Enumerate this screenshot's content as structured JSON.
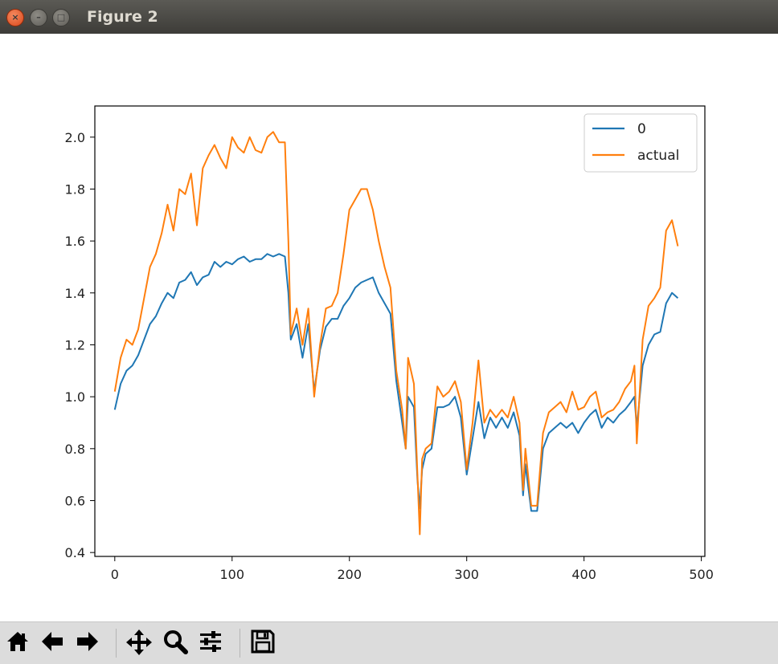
{
  "window": {
    "title": "Figure 2"
  },
  "window_controls": {
    "close_glyph": "×",
    "minimize_glyph": "–",
    "maximize_glyph": "□"
  },
  "toolbar": {
    "buttons": [
      {
        "name": "home",
        "icon": "home-icon"
      },
      {
        "name": "back",
        "icon": "arrow-left-icon"
      },
      {
        "name": "forward",
        "icon": "arrow-right-icon"
      },
      {
        "name": "pan",
        "icon": "move-icon"
      },
      {
        "name": "zoom",
        "icon": "magnifier-icon"
      },
      {
        "name": "configure",
        "icon": "sliders-icon"
      },
      {
        "name": "save",
        "icon": "floppy-disk-icon"
      }
    ]
  },
  "colors": {
    "series0": "#1f77b4",
    "actual": "#ff7f0e",
    "titlebar": "#4a4945",
    "toolbar": "#dcdcdc"
  },
  "chart_data": {
    "type": "line",
    "title": "",
    "xlabel": "",
    "ylabel": "",
    "xlim": [
      -17,
      503
    ],
    "ylim": [
      0.385,
      2.12
    ],
    "xticks": [
      0,
      100,
      200,
      300,
      400,
      500
    ],
    "yticks": [
      0.4,
      0.6,
      0.8,
      1.0,
      1.2,
      1.4,
      1.6,
      1.8,
      2.0
    ],
    "grid": false,
    "legend_position": "top-right",
    "series": [
      {
        "name": "0",
        "color": "#1f77b4",
        "x": [
          0,
          5,
          10,
          15,
          20,
          25,
          30,
          35,
          40,
          45,
          50,
          55,
          60,
          65,
          70,
          75,
          80,
          85,
          90,
          95,
          100,
          105,
          110,
          115,
          120,
          125,
          130,
          135,
          140,
          145,
          148,
          150,
          155,
          160,
          165,
          170,
          175,
          180,
          185,
          190,
          195,
          200,
          205,
          210,
          215,
          220,
          225,
          230,
          235,
          240,
          245,
          248,
          250,
          255,
          258,
          260,
          262,
          265,
          270,
          275,
          280,
          285,
          290,
          295,
          300,
          305,
          310,
          315,
          320,
          325,
          330,
          335,
          340,
          345,
          348,
          350,
          355,
          360,
          365,
          370,
          375,
          380,
          385,
          390,
          395,
          400,
          405,
          410,
          415,
          420,
          425,
          430,
          435,
          440,
          443,
          445,
          450,
          455,
          460,
          465,
          470,
          475,
          480
        ],
        "y": [
          0.95,
          1.05,
          1.1,
          1.12,
          1.16,
          1.22,
          1.28,
          1.31,
          1.36,
          1.4,
          1.38,
          1.44,
          1.45,
          1.48,
          1.43,
          1.46,
          1.47,
          1.52,
          1.5,
          1.52,
          1.51,
          1.53,
          1.54,
          1.52,
          1.53,
          1.53,
          1.55,
          1.54,
          1.55,
          1.54,
          1.4,
          1.22,
          1.28,
          1.15,
          1.28,
          1.02,
          1.18,
          1.27,
          1.3,
          1.3,
          1.35,
          1.38,
          1.42,
          1.44,
          1.45,
          1.46,
          1.4,
          1.36,
          1.32,
          1.06,
          0.9,
          0.8,
          1.0,
          0.96,
          0.68,
          0.57,
          0.72,
          0.78,
          0.8,
          0.96,
          0.96,
          0.97,
          1.0,
          0.92,
          0.7,
          0.84,
          0.98,
          0.84,
          0.92,
          0.88,
          0.92,
          0.88,
          0.94,
          0.85,
          0.62,
          0.74,
          0.56,
          0.56,
          0.8,
          0.86,
          0.88,
          0.9,
          0.88,
          0.9,
          0.86,
          0.9,
          0.93,
          0.95,
          0.88,
          0.92,
          0.9,
          0.93,
          0.95,
          0.98,
          1.0,
          0.88,
          1.12,
          1.2,
          1.24,
          1.25,
          1.36,
          1.4,
          1.38
        ]
      },
      {
        "name": "actual",
        "color": "#ff7f0e",
        "x": [
          0,
          5,
          10,
          15,
          20,
          25,
          30,
          35,
          40,
          45,
          50,
          55,
          60,
          65,
          70,
          75,
          80,
          85,
          90,
          95,
          100,
          105,
          110,
          115,
          120,
          125,
          130,
          135,
          140,
          145,
          148,
          150,
          155,
          160,
          165,
          170,
          175,
          180,
          185,
          190,
          195,
          200,
          205,
          210,
          215,
          220,
          225,
          230,
          235,
          240,
          245,
          248,
          250,
          255,
          258,
          260,
          262,
          265,
          270,
          275,
          280,
          285,
          290,
          295,
          300,
          305,
          310,
          315,
          320,
          325,
          330,
          335,
          340,
          345,
          348,
          350,
          355,
          360,
          365,
          370,
          375,
          380,
          385,
          390,
          395,
          400,
          405,
          410,
          415,
          420,
          425,
          430,
          435,
          440,
          443,
          445,
          450,
          455,
          460,
          465,
          470,
          475,
          480
        ],
        "y": [
          1.02,
          1.15,
          1.22,
          1.2,
          1.26,
          1.38,
          1.5,
          1.55,
          1.63,
          1.74,
          1.64,
          1.8,
          1.78,
          1.86,
          1.66,
          1.88,
          1.93,
          1.97,
          1.92,
          1.88,
          2.0,
          1.96,
          1.94,
          2.0,
          1.95,
          1.94,
          2.0,
          2.02,
          1.98,
          1.98,
          1.6,
          1.24,
          1.34,
          1.2,
          1.34,
          1.0,
          1.2,
          1.34,
          1.35,
          1.4,
          1.55,
          1.72,
          1.76,
          1.8,
          1.8,
          1.72,
          1.6,
          1.5,
          1.42,
          1.1,
          0.95,
          0.8,
          1.15,
          1.05,
          0.7,
          0.47,
          0.76,
          0.8,
          0.82,
          1.04,
          1.0,
          1.02,
          1.06,
          0.98,
          0.72,
          0.9,
          1.14,
          0.9,
          0.95,
          0.92,
          0.95,
          0.92,
          1.0,
          0.9,
          0.64,
          0.8,
          0.58,
          0.58,
          0.86,
          0.94,
          0.96,
          0.98,
          0.94,
          1.02,
          0.95,
          0.96,
          1.0,
          1.02,
          0.92,
          0.94,
          0.95,
          0.98,
          1.03,
          1.06,
          1.12,
          0.82,
          1.22,
          1.35,
          1.38,
          1.42,
          1.64,
          1.68,
          1.58
        ]
      }
    ]
  }
}
